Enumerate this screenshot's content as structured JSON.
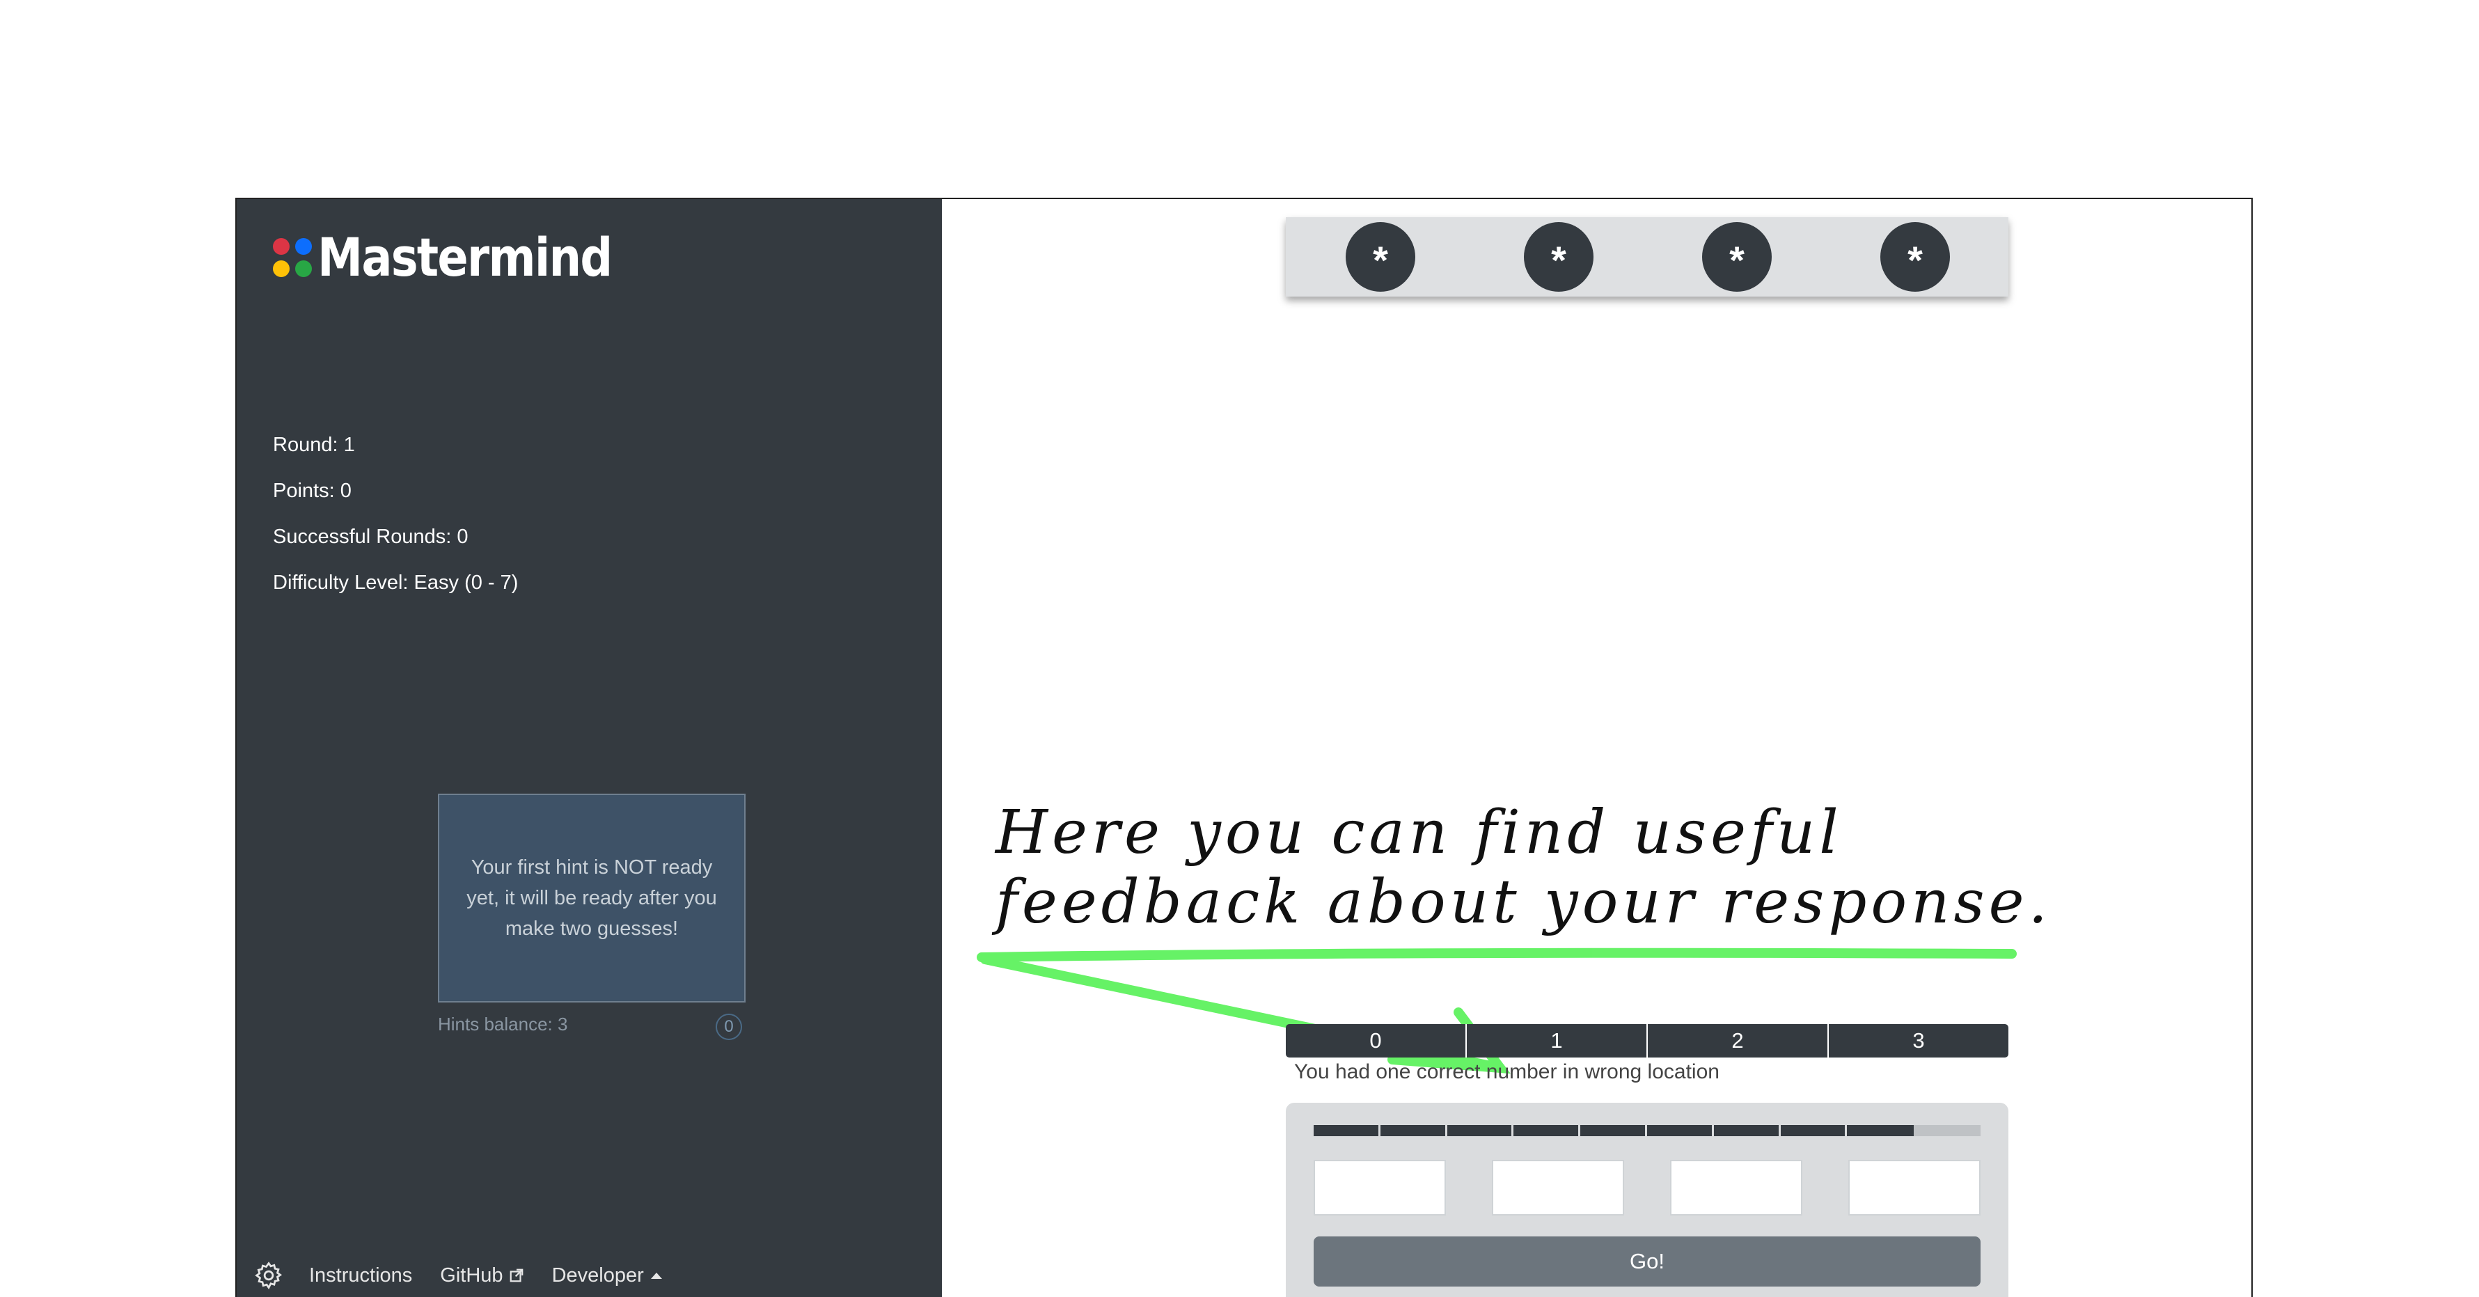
{
  "app": {
    "title": "Mastermind",
    "logo_colors": [
      "#dc3545",
      "#0d6efd",
      "#ffc107",
      "#28a745"
    ]
  },
  "sidebar": {
    "stats": [
      {
        "label": "Round: 1"
      },
      {
        "label": "Points: 0"
      },
      {
        "label": "Successful Rounds: 0"
      },
      {
        "label": "Difficulty Level: Easy (0 - 7)"
      }
    ],
    "hint": {
      "message": "Your first hint is NOT ready yet, it will be ready after you make two guesses!",
      "balance_label": "Hints balance: 3",
      "count": "0"
    },
    "footer": {
      "settings_icon": "gear-icon",
      "instructions": "Instructions",
      "github": "GitHub",
      "developer": "Developer"
    }
  },
  "secret": {
    "pegs": [
      "*",
      "*",
      "*",
      "*"
    ]
  },
  "annotation": {
    "line1": "Here you can find useful",
    "line2": "feedback about your response.",
    "arrow_color": "#4cf04c"
  },
  "feedback": {
    "positions": [
      "0",
      "1",
      "2",
      "3"
    ],
    "message": "You had one correct number in wrong location"
  },
  "guess": {
    "attempts_progress": 0.9,
    "inputs": [
      "",
      "",
      "",
      ""
    ],
    "go_label": "Go!"
  },
  "colors": {
    "sidebar_bg": "#343a40",
    "hint_bg": "#3e5267",
    "button_bg": "#6c757d"
  }
}
